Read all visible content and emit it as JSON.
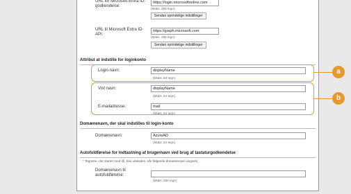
{
  "urls": {
    "entra_id_label": "URL for Microsoft Entra ID-godkendelse:",
    "entra_id_value": "https://login.microsoftonline.com",
    "entra_id_hint": "(Maks. 255 tegn)",
    "entra_id_reset": "Sendan oprindelige indstillinger",
    "api_label": "URL til Microsoft Entra ID-API:",
    "api_value": "https://graph.microsoft.com",
    "api_hint": "(Maks. 255 tegn)",
    "api_reset": "Sendan oprindelige indstillinger"
  },
  "attribute_section": {
    "title": "Attribut at indstille for loginkonto",
    "login_name_label": "Login-navn:",
    "login_name_value": "displayName",
    "login_name_hint": "(Maks. 64 tegn)",
    "display_name_label": "Vist navn:",
    "display_name_value": "displayName",
    "display_name_hint": "(Maks. 64 tegn)",
    "email_label": "E-mailadresse:",
    "email_value": "mail",
    "email_hint": "(Maks. 64 tegn)"
  },
  "domain_section": {
    "title": "Domænenavn, der skal indstilles til login-konto",
    "domain_label": "Domænenavn:",
    "domain_value": "AzureAD",
    "domain_hint": "(Maks. 64 tegn)"
  },
  "autocomplete_section": {
    "title": "Autofuldførelse for indtastning af brugernavn ved brug af tastaturgodkendelse",
    "note": "* Tegnene, der starter med @, kan udelades, når følgende domænenavn angives.",
    "domain_label": "Domænenavn til autofuldførelse:",
    "domain_value": "",
    "domain_hint": "(Maks. 255 tegn)"
  },
  "callouts": {
    "a": "a",
    "b": "b"
  },
  "colors": {
    "highlight": "#e69a2e"
  }
}
